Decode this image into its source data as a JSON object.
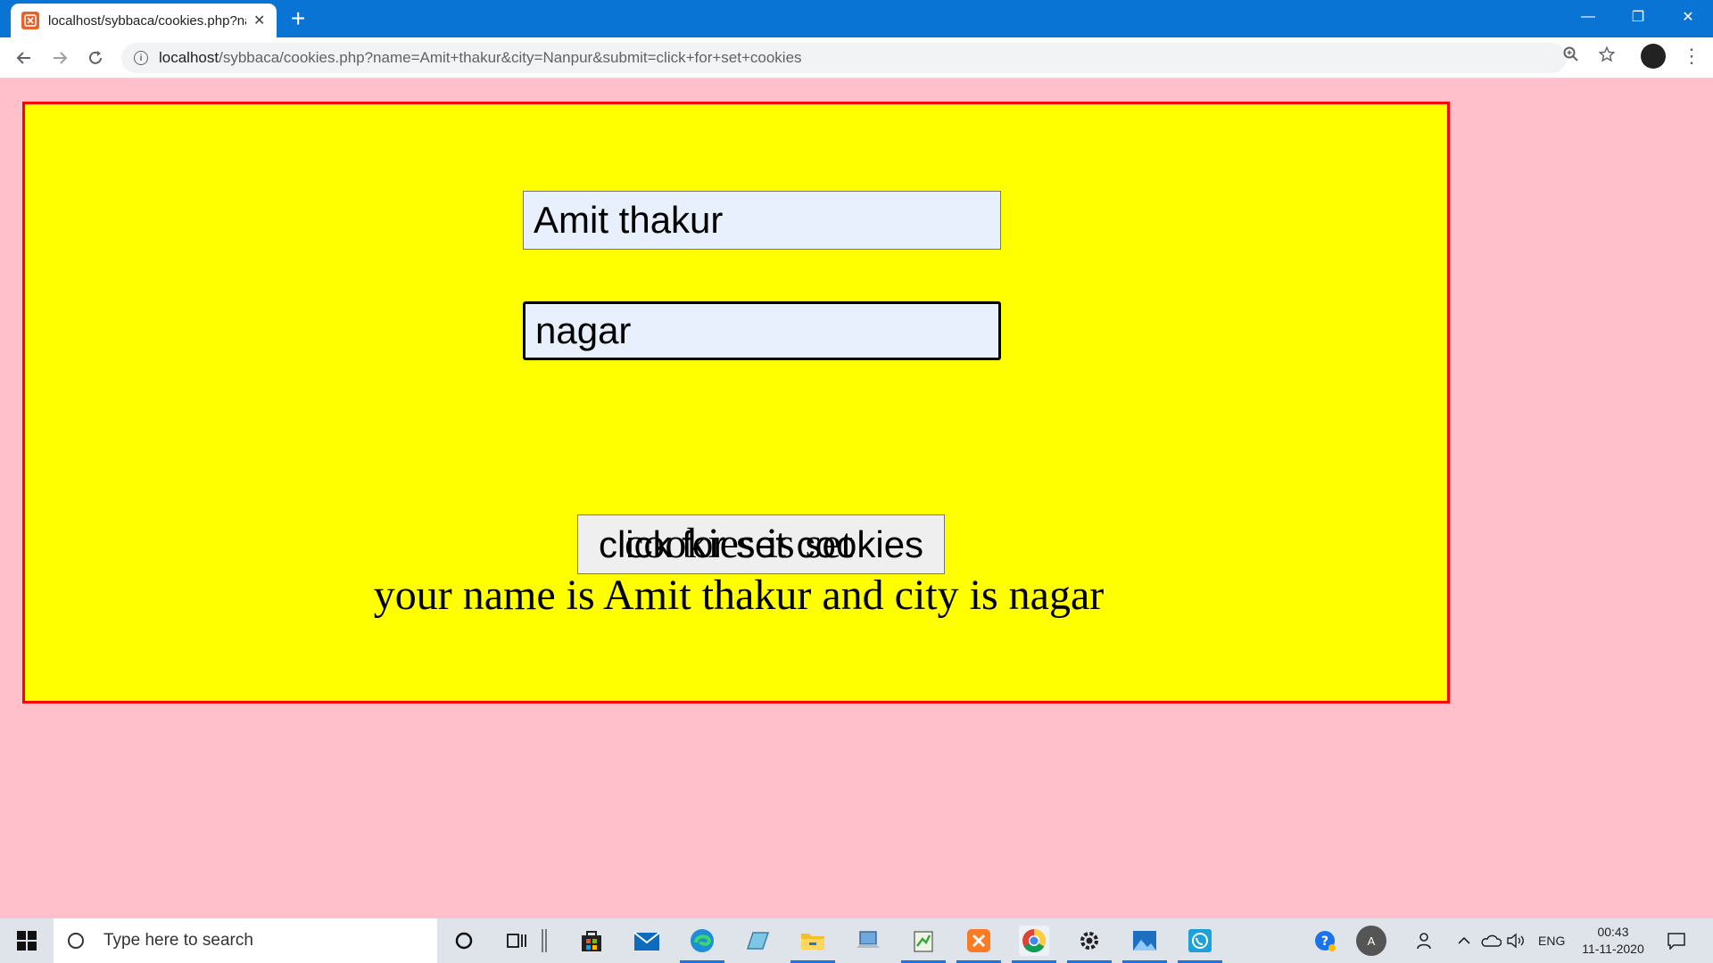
{
  "browser": {
    "tab_title": "localhost/sybbaca/cookies.php?name=Amit",
    "tab_close": "✕",
    "new_tab": "+",
    "url_host": "localhost",
    "url_rest": "/sybbaca/cookies.php?name=Amit+thakur&city=Nanpur&submit=click+for+set+cookies",
    "window_minimize": "—",
    "window_restore": "❐",
    "window_close": "✕"
  },
  "form": {
    "name_value": "Amit thakur",
    "city_value": "nagar",
    "submit_label": "click for set cookies"
  },
  "output": {
    "line1": "cookies is set",
    "line2": "your name is Amit thakur and city is nagar"
  },
  "taskbar": {
    "search_placeholder": "Type here to search",
    "language": "ENG",
    "time": "00:43",
    "date": "11-11-2020",
    "user_initial": "A"
  },
  "colors": {
    "page_background": "#ffc0cb",
    "box_background": "#ffff00",
    "box_border": "#ff0000",
    "titlebar": "#0a74d4"
  }
}
